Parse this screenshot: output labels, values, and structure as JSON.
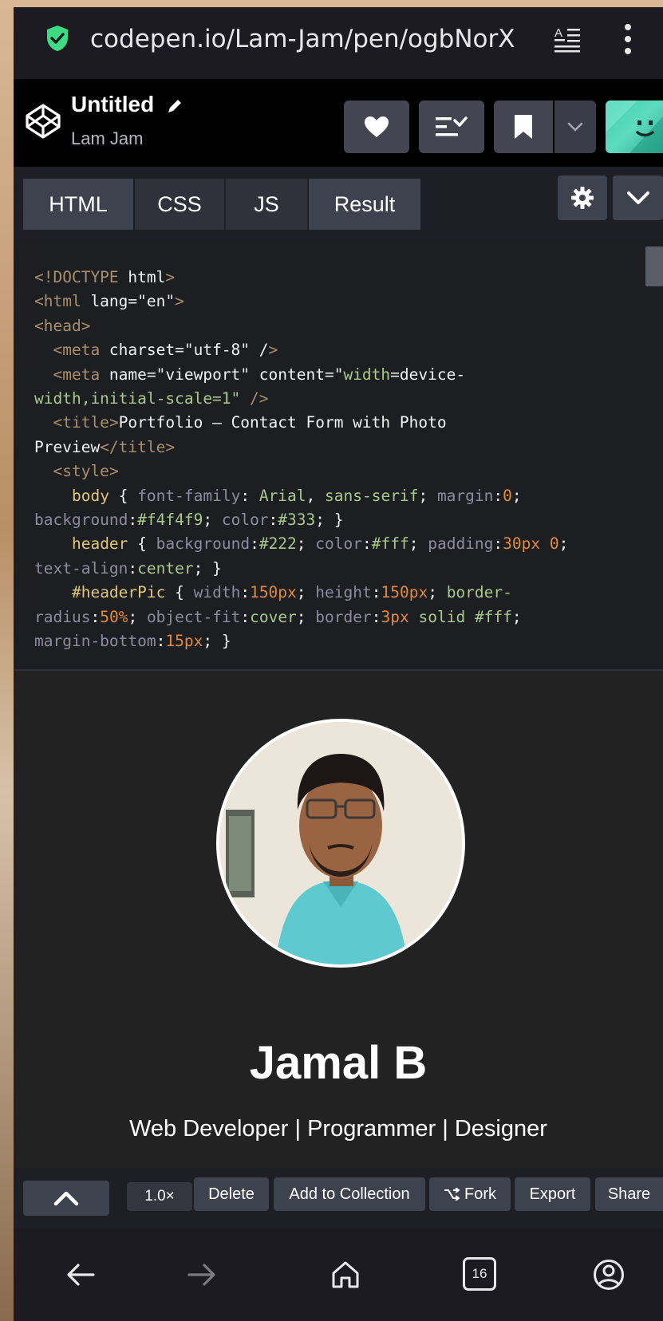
{
  "browser": {
    "url": "codepen.io/Lam-Jam/pen/ogbNorX",
    "tab_count": "16"
  },
  "pen": {
    "title": "Untitled",
    "author": "Lam Jam"
  },
  "tabs": [
    {
      "label": "HTML"
    },
    {
      "label": "CSS"
    },
    {
      "label": "JS"
    },
    {
      "label": "Result"
    }
  ],
  "code_lines": [
    "<!DOCTYPE html>",
    "<html lang=\"en\">",
    "<head>",
    "  <meta charset=\"utf-8\" />",
    "  <meta name=\"viewport\" content=\"width=device-",
    "width,initial-scale=1\" />",
    "  <title>Portfolio — Contact Form with Photo",
    "Preview</title>",
    "  <style>",
    "    body { font-family: Arial, sans-serif; margin:0;",
    "background:#f4f4f9; color:#333; }",
    "    header { background:#222; color:#fff; padding:30px 0;",
    "text-align:center; }",
    "    #headerPic { width:150px; height:150px; border-",
    "radius:50%; object-fit:cover; border:3px solid #fff;",
    "margin-bottom:15px; }"
  ],
  "preview": {
    "name": "Jamal B",
    "tagline": "Web Developer | Programmer | Designer"
  },
  "toolbar": {
    "zoom": "1.0×",
    "delete": "Delete",
    "add_to_collection": "Add to Collection",
    "fork": "Fork",
    "export": "Export",
    "share": "Share"
  },
  "colors": {
    "accent_green": "#47cf73",
    "editor_bg": "#1d1e22",
    "button_bg": "#3e424e"
  }
}
